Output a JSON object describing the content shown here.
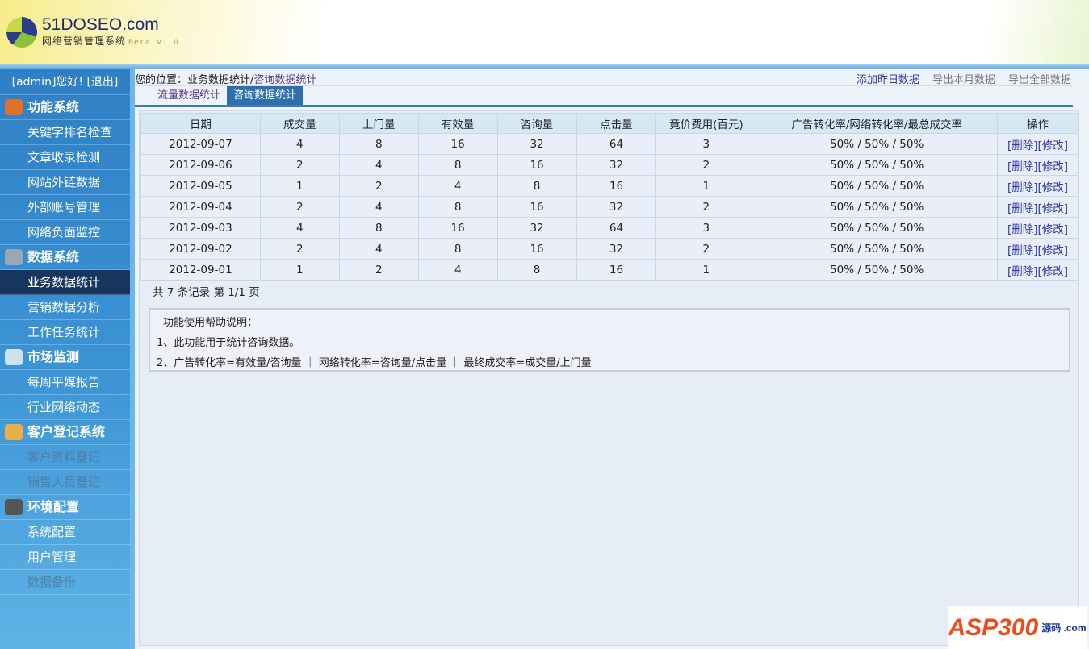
{
  "header": {
    "logo_title": "51DOSEO.com",
    "logo_subtitle": "网络营销管理系统",
    "version": "Beta v1.0"
  },
  "sidebar": {
    "user": "[admin]您好!  [退出]",
    "items": [
      {
        "type": "cat",
        "label": "功能系统",
        "icon": "diamond-icon",
        "color": "#e0702a"
      },
      {
        "label": "关键字排名检查"
      },
      {
        "label": "文章收录检测"
      },
      {
        "label": "网站外链数据"
      },
      {
        "label": "外部账号管理"
      },
      {
        "label": "网络负面监控"
      },
      {
        "type": "cat",
        "label": "数据系统",
        "icon": "database-icon",
        "color": "#9aa7b4"
      },
      {
        "label": "业务数据统计",
        "active": true
      },
      {
        "label": "营销数据分析"
      },
      {
        "label": "工作任务统计"
      },
      {
        "type": "cat",
        "label": "市场监测",
        "icon": "report-icon",
        "color": "#cfe0ee"
      },
      {
        "label": "每周平媒报告"
      },
      {
        "label": "行业网络动态"
      },
      {
        "type": "cat",
        "label": "客户登记系统",
        "icon": "users-icon",
        "color": "#e8b04a"
      },
      {
        "label": "客户资料登记",
        "disabled": true
      },
      {
        "label": "销售人员登记",
        "disabled": true
      },
      {
        "type": "cat",
        "label": "环境配置",
        "icon": "tools-icon",
        "color": "#555"
      },
      {
        "label": "系统配置"
      },
      {
        "label": "用户管理"
      },
      {
        "label": "数据备份",
        "disabled": true
      }
    ]
  },
  "breadcrumb": {
    "prefix": "您的位置：业务数据统计/",
    "current": "咨询数据统计"
  },
  "actions": [
    "添加昨日数据",
    "导出本月数据",
    "导出全部数据"
  ],
  "tabs": [
    {
      "label": "流量数据统计"
    },
    {
      "label": "咨询数据统计",
      "active": true
    }
  ],
  "table": {
    "headers": [
      "日期",
      "成交量",
      "上门量",
      "有效量",
      "咨询量",
      "点击量",
      "竟价费用(百元)",
      "广告转化率/网络转化率/最总成交率",
      "操作"
    ],
    "rows": [
      [
        "2012-09-07",
        "4",
        "8",
        "16",
        "32",
        "64",
        "3",
        "50% / 50% / 50%"
      ],
      [
        "2012-09-06",
        "2",
        "4",
        "8",
        "16",
        "32",
        "2",
        "50% / 50% / 50%"
      ],
      [
        "2012-09-05",
        "1",
        "2",
        "4",
        "8",
        "16",
        "1",
        "50% / 50% / 50%"
      ],
      [
        "2012-09-04",
        "2",
        "4",
        "8",
        "16",
        "32",
        "2",
        "50% / 50% / 50%"
      ],
      [
        "2012-09-03",
        "4",
        "8",
        "16",
        "32",
        "64",
        "3",
        "50% / 50% / 50%"
      ],
      [
        "2012-09-02",
        "2",
        "4",
        "8",
        "16",
        "32",
        "2",
        "50% / 50% / 50%"
      ],
      [
        "2012-09-01",
        "1",
        "2",
        "4",
        "8",
        "16",
        "1",
        "50% / 50% / 50%"
      ]
    ],
    "delete_label": "[删除]",
    "edit_label": "[修改]"
  },
  "pager": "共 7 条记录 第 1/1 页",
  "help": [
    "功能使用帮助说明：",
    "1、此功能用于统计咨询数据。",
    "2、广告转化率=有效量/咨询量 ｜ 网络转化率=咨询量/点击量 ｜ 最终成交率=成交量/上门量"
  ],
  "watermark": {
    "text": "ASP300",
    "suffix": "源码 .com"
  }
}
